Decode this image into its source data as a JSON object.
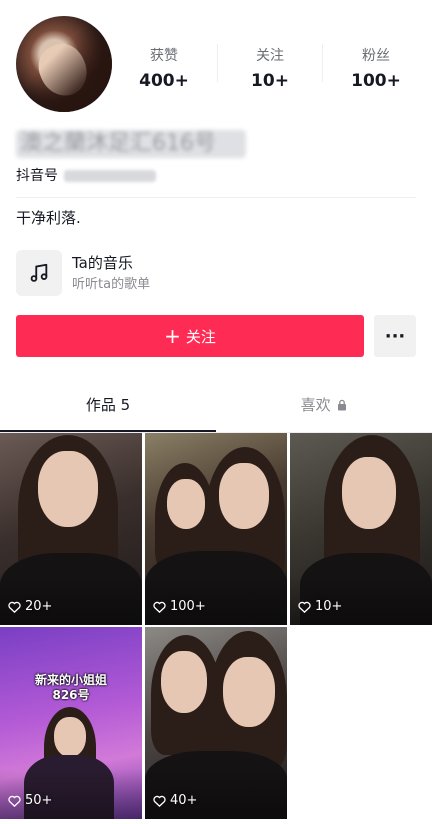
{
  "profile": {
    "stats": [
      {
        "label": "获赞",
        "value": "400+"
      },
      {
        "label": "关注",
        "value": "10+"
      },
      {
        "label": "粉丝",
        "value": "100+"
      }
    ],
    "name_blurred": "澳之蘭沐足汇616号",
    "douyin_label": "抖音号",
    "douyin_id_blurred": "45723861083",
    "bio": "干净利落."
  },
  "music": {
    "title": "Ta的音乐",
    "subtitle": "听听ta的歌单",
    "icon": "music-note-icon"
  },
  "actions": {
    "follow_label": "关注",
    "more_label": "···"
  },
  "tabs": [
    {
      "label": "作品 5",
      "active": true
    },
    {
      "label": "喜欢",
      "active": false,
      "icon": "lock-icon"
    }
  ],
  "posts": [
    {
      "likes": "20+"
    },
    {
      "likes": "100+"
    },
    {
      "likes": "10+"
    },
    {
      "likes": "50+",
      "overlay_line1": "新来的小姐姐",
      "overlay_line2": "826号"
    },
    {
      "likes": "40+"
    }
  ],
  "colors": {
    "accent": "#fe2c55",
    "text": "#161823",
    "muted": "#8a8b91"
  }
}
